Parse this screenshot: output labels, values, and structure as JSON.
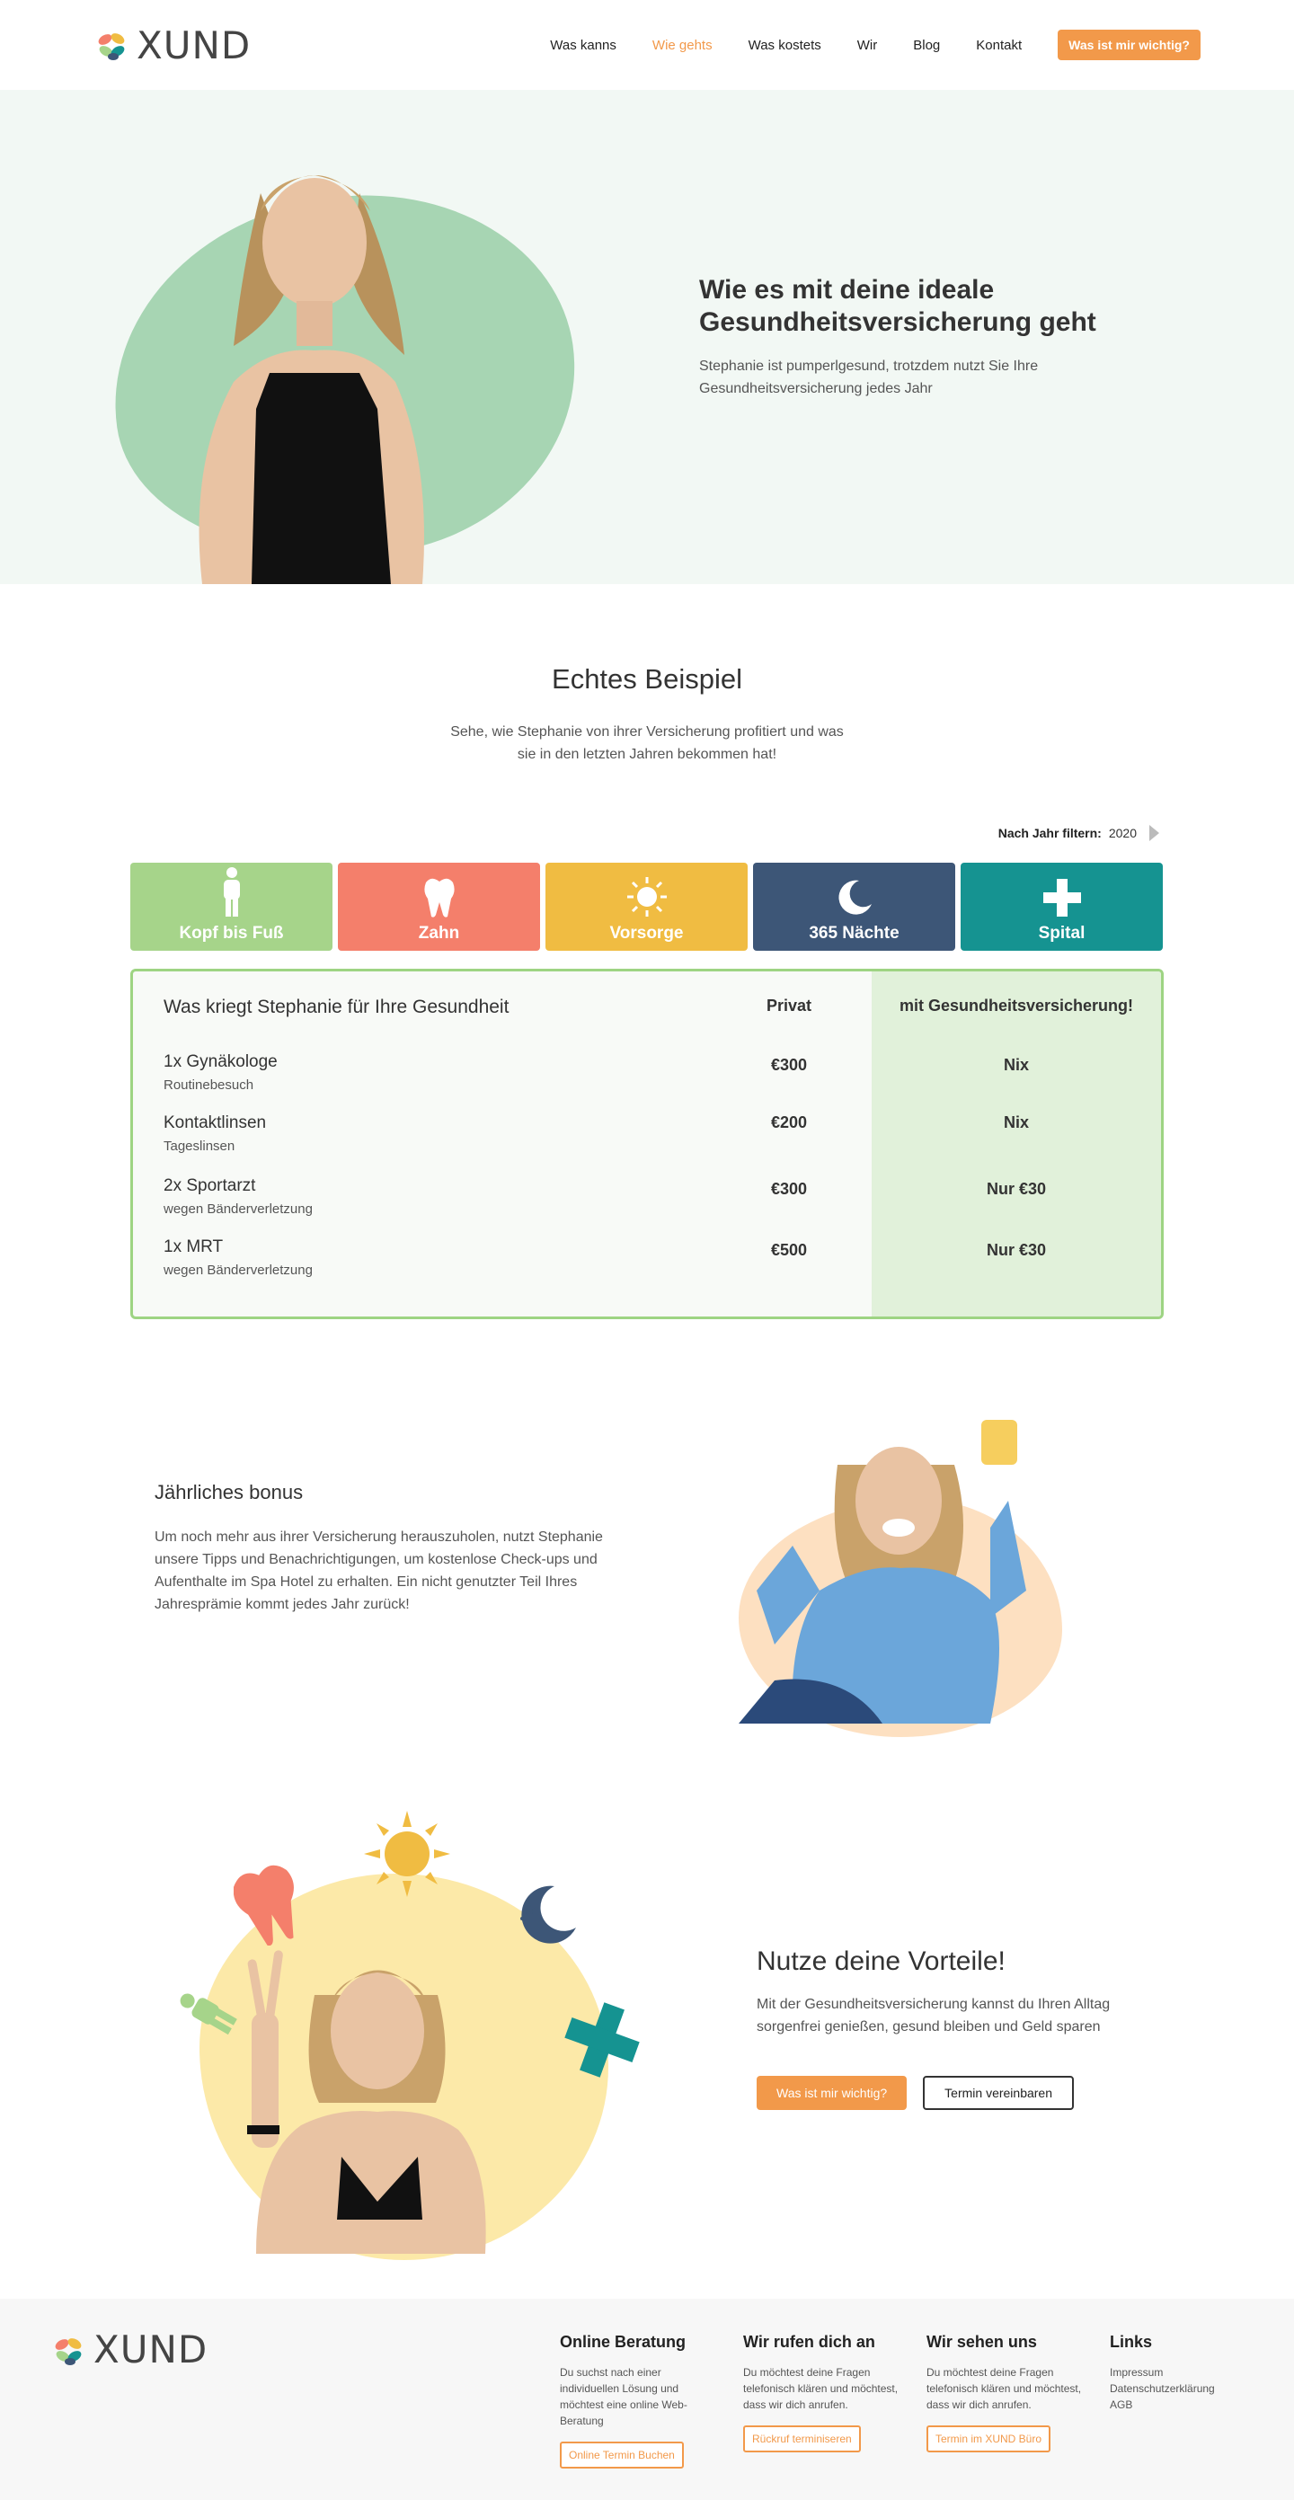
{
  "header": {
    "logo_text": "XUND",
    "nav": [
      "Was kanns",
      "Wie gehts",
      "Was kostets",
      "Wir",
      "Blog",
      "Kontakt"
    ],
    "cta": "Was ist mir wichtig?"
  },
  "hero": {
    "title": "Wie es mit deine ideale Gesundheitsversicherung geht",
    "subtitle": "Stephanie ist pumperlgesund, trotzdem nutzt Sie Ihre Gesundheitsversicherung jedes Jahr"
  },
  "example": {
    "title": "Echtes Beispiel",
    "subtitle": "Sehe, wie Stephanie von ihrer Versicherung profitiert und was sie in den letzten Jahren bekommen hat!",
    "filter_label": "Nach Jahr filtern:",
    "filter_year": "2020",
    "categories": [
      {
        "label": "Kopf bis Fuß",
        "color": "#a6d48a",
        "icon": "person-icon"
      },
      {
        "label": "Zahn",
        "color": "#f47f6b",
        "icon": "tooth-icon"
      },
      {
        "label": "Vorsorge",
        "color": "#f0bc42",
        "icon": "sun-icon"
      },
      {
        "label": "365 Nächte",
        "color": "#3d5677",
        "icon": "moon-icon"
      },
      {
        "label": "Spital",
        "color": "#159391",
        "icon": "cross-icon"
      }
    ],
    "table": {
      "head_title": "Was kriegt Stephanie für Ihre Gesundheit",
      "head_private": "Privat",
      "head_insured": "mit Gesundheitsversicherung!",
      "rows": [
        {
          "name": "1x Gynäkologe",
          "sub": "Routinebesuch",
          "private": "€300",
          "insured": "Nix"
        },
        {
          "name": "Kontaktlinsen",
          "sub": "Tageslinsen",
          "private": "€200",
          "insured": "Nix"
        },
        {
          "name": "2x Sportarzt",
          "sub": "wegen Bänderverletzung",
          "private": "€300",
          "insured": "Nur €30"
        },
        {
          "name": "1x MRT",
          "sub": "wegen Bänderverletzung",
          "private": "€500",
          "insured": "Nur €30"
        }
      ]
    }
  },
  "bonus": {
    "title": "Jährliches bonus",
    "text": "Um noch mehr aus ihrer Versicherung herauszuholen, nutzt Stephanie unsere Tipps und Benachrichtigungen, um kostenlose Check-ups und Aufenthalte im Spa Hotel zu erhalten. Ein nicht genutzter Teil Ihres Jahresprämie kommt jedes Jahr zurück!"
  },
  "vorteile": {
    "title": "Nutze deine Vorteile!",
    "text": "Mit der Gesundheitsversicherung kannst du Ihren Alltag sorgenfrei genießen, gesund bleiben und Geld sparen",
    "btn_primary": "Was ist mir wichtig?",
    "btn_secondary": "Termin vereinbaren"
  },
  "footer": {
    "logo_text": "XUND",
    "cols": [
      {
        "title": "Online Beratung",
        "text": "Du suchst nach einer individuellen Lösung und möchtest eine online Web-Beratung",
        "button": "Online Termin Buchen"
      },
      {
        "title": "Wir rufen dich an",
        "text": "Du möchtest deine Fragen telefonisch klären und möchtest, dass wir dich anrufen.",
        "button": "Rückruf terminiseren"
      },
      {
        "title": "Wir sehen uns",
        "text": "Du möchtest deine Fragen telefonisch klären und möchtest, dass wir dich anrufen.",
        "button": "Termin im XUND Büro"
      }
    ],
    "links_title": "Links",
    "links": [
      "Impressum",
      "Datenschutzerklärung",
      "AGB"
    ]
  }
}
